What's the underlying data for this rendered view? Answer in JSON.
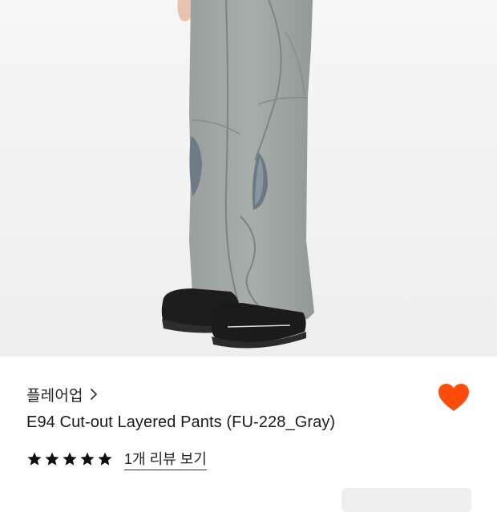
{
  "product": {
    "image_alt": "E94 Cut-out Layered Pants (FU-228_Gray)",
    "brand": "플레어업",
    "title": "E94 Cut-out Layered Pants (FU-228_Gray)",
    "favorite_color": "#ff4c0b",
    "rating": {
      "stars": 5,
      "max_stars": 5,
      "review_link": "1개 리뷰 보기"
    }
  }
}
